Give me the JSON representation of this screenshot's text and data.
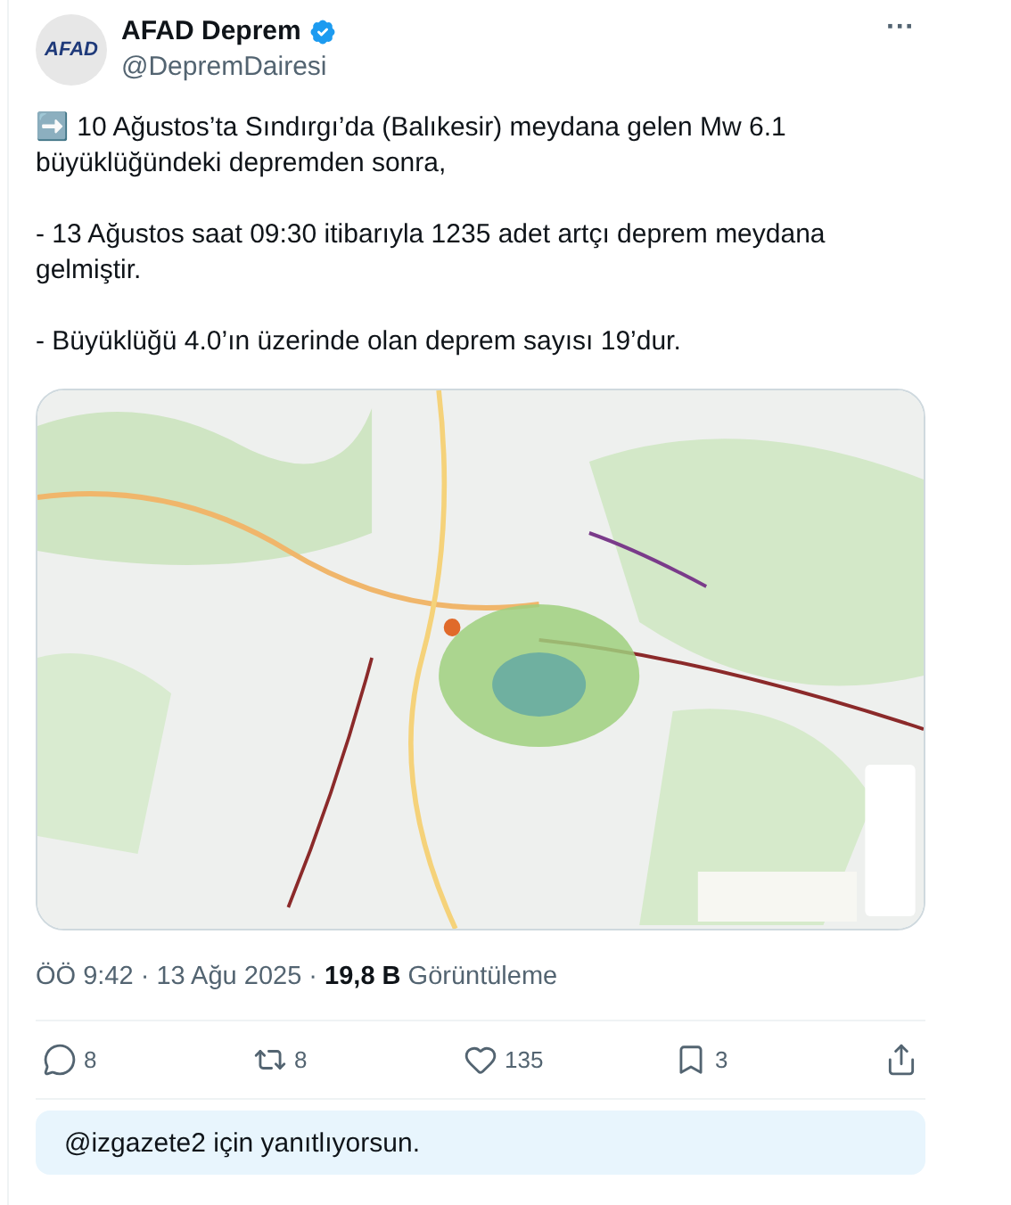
{
  "author": {
    "avatar_text": "AFAD",
    "name": "AFAD Deprem",
    "verified": true,
    "handle": "@DepremDairesi"
  },
  "menu": "···",
  "paragraphs": [
    "➡️ 10 Ağustos’ta Sındırgı’da (Balıkesir) meydana gelen Mw 6.1 büyüklüğündeki depremden sonra,",
    "- 13 Ağustos saat 09:30 itibarıyla 1235 adet artçı deprem meydana gelmiştir.",
    "- Büyüklüğü 4.0’ın üzerinde olan deprem sayısı 19’dur."
  ],
  "meta": "ÖÖ 9:42 · 13 Ağu 2025 · **19,8 B** Görüntüleme",
  "actions": [
    {
      "kind": "reply",
      "count": "8"
    },
    {
      "kind": "repost",
      "count": "8"
    },
    {
      "kind": "like",
      "count": "135"
    },
    {
      "kind": "bookmark",
      "count": "3"
    },
    {
      "kind": "share"
    }
  ],
  "reply_box": {
    "placeholder": "@izgazete2 için yanıtlıyorsun."
  }
}
